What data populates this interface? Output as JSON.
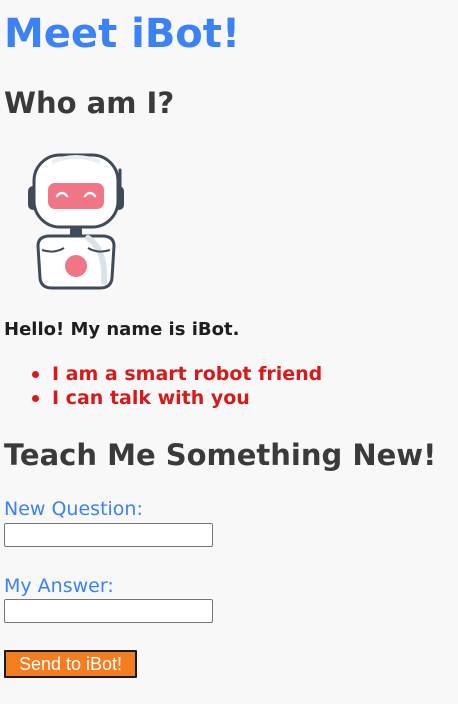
{
  "page": {
    "title": "Meet iBot!",
    "who_heading": "Who am I?",
    "hello_text": "Hello! My name is iBot.",
    "facts": [
      "I am a smart robot friend",
      "I can talk with you"
    ],
    "teach_heading": "Teach Me Something New!"
  },
  "form": {
    "question_label": "New Question:",
    "question_value": "",
    "answer_label": "My Answer:",
    "answer_value": "",
    "send_label": "Send to iBot!"
  },
  "colors": {
    "title": "#3b82f6",
    "heading": "#3a3a3a",
    "fact": "#d71919",
    "label": "#3b82f6",
    "button": "#f47d1f",
    "robot_face": "#f07585"
  },
  "icons": {
    "robot": "robot-illustration"
  }
}
